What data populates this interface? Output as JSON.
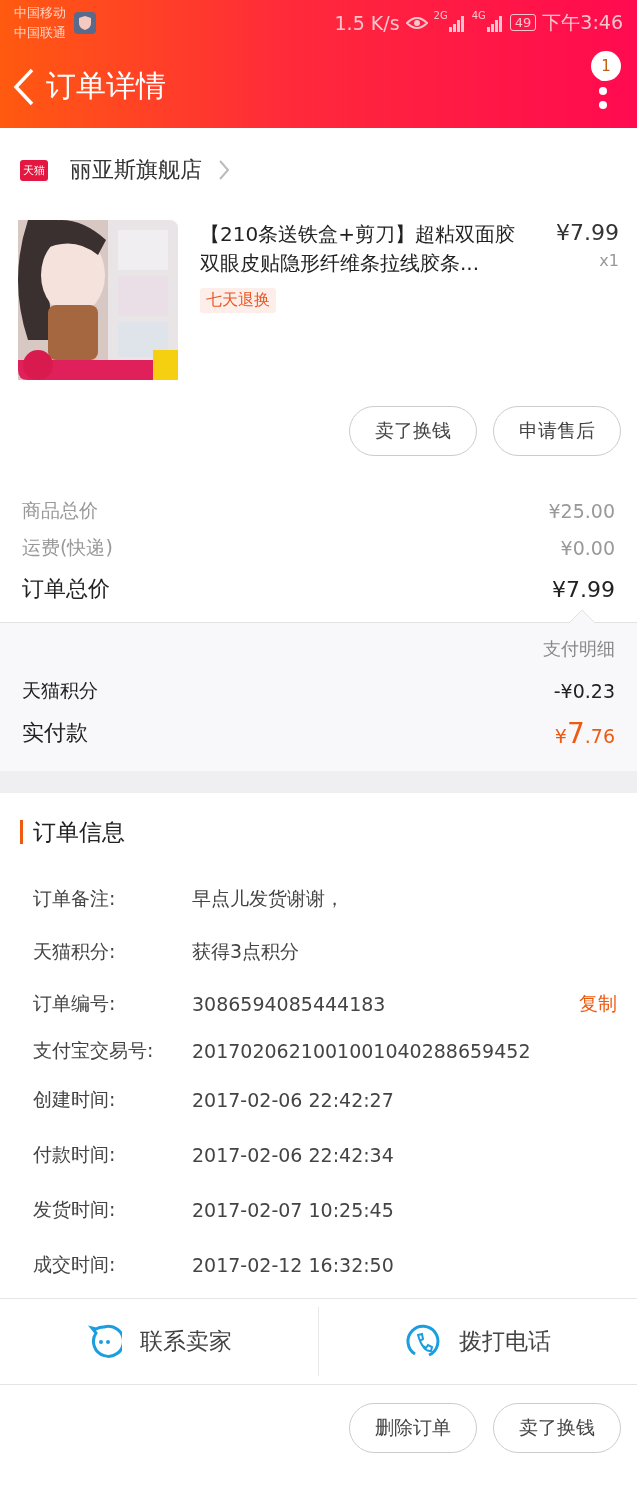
{
  "status_bar": {
    "carrier_1": "中国移动",
    "carrier_2": "中国联通",
    "speed": "1.5 K/s",
    "network_1": "2G",
    "network_2": "4G",
    "battery": "49",
    "time": "下午3:46"
  },
  "header": {
    "title": "订单详情",
    "badge": "1"
  },
  "store": {
    "name": "丽亚斯旗舰店",
    "badge": "天猫"
  },
  "product": {
    "title": "【210条送铁盒+剪刀】超粘双面胶双眼皮贴隐形纤维条拉线胶条...",
    "price": "¥7.99",
    "quantity": "x1",
    "tag": "七天退换"
  },
  "item_actions": [
    "卖了换钱",
    "申请售后"
  ],
  "price_rows": [
    {
      "label": "商品总价",
      "value": "¥25.00",
      "kind": "minor"
    },
    {
      "label": "运费(快递)",
      "value": "¥0.00",
      "kind": "minor"
    },
    {
      "label": "订单总价",
      "value": "¥7.99",
      "kind": "major"
    }
  ],
  "payment": {
    "detail_link": "支付明细",
    "rows": [
      {
        "label": "天猫积分",
        "value": "-¥0.23"
      }
    ],
    "paid_label": "实付款",
    "paid_currency": "¥",
    "paid_int": "7",
    "paid_dec": ".76"
  },
  "order_info": {
    "title": "订单信息",
    "rows": [
      {
        "label": "订单备注:",
        "value": "早点儿发货谢谢，"
      },
      {
        "label": "天猫积分:",
        "value": "获得3点积分"
      },
      {
        "label": "订单编号:",
        "value": "3086594085444183",
        "action": "复制"
      },
      {
        "label": "支付宝交易号:",
        "value": "2017020621001001040288659452"
      },
      {
        "label": "创建时间:",
        "value": "2017-02-06 22:42:27"
      },
      {
        "label": "付款时间:",
        "value": "2017-02-06 22:42:34"
      },
      {
        "label": "发货时间:",
        "value": "2017-02-07 10:25:45"
      },
      {
        "label": "成交时间:",
        "value": "2017-02-12 16:32:50"
      }
    ]
  },
  "contact": [
    {
      "label": "联系卖家",
      "kind": "chat"
    },
    {
      "label": "拨打电话",
      "kind": "phone"
    }
  ],
  "bottom_actions": [
    "删除订单",
    "卖了换钱"
  ]
}
